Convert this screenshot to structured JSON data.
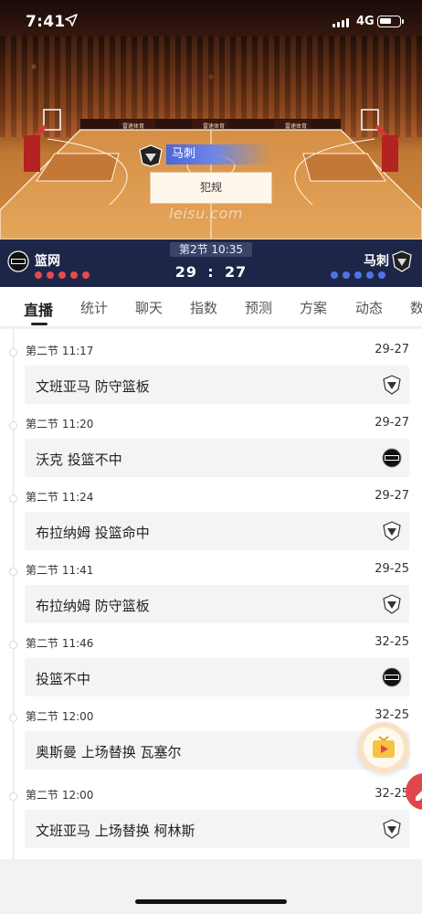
{
  "status_bar": {
    "time": "7:41",
    "network": "4G"
  },
  "live_event": {
    "team": "马刺",
    "action": "犯规",
    "watermark": "leisu.com"
  },
  "court_ads": [
    "雷速体育",
    "雷速体育",
    "雷速体育"
  ],
  "match": {
    "home_team": "篮网",
    "away_team": "马刺",
    "period_clock": "第2节 10:35",
    "home_score": "29",
    "away_score": "27",
    "separator": ":"
  },
  "team_logos": {
    "home": "NETS",
    "away": "SPURS"
  },
  "tabs": [
    {
      "label": "直播",
      "active": true
    },
    {
      "label": "统计"
    },
    {
      "label": "聊天"
    },
    {
      "label": "指数"
    },
    {
      "label": "预测"
    },
    {
      "label": "方案"
    },
    {
      "label": "动态"
    },
    {
      "label": "数"
    }
  ],
  "events": [
    {
      "time": "第二节 11:17",
      "score": "29-27",
      "text": "文班亚马 防守篮板",
      "team": "spurs"
    },
    {
      "time": "第二节 11:20",
      "score": "29-27",
      "text": "沃克 投篮不中",
      "team": "nets"
    },
    {
      "time": "第二节 11:24",
      "score": "29-27",
      "text": "布拉纳姆 投篮命中",
      "team": "spurs"
    },
    {
      "time": "第二节 11:41",
      "score": "29-25",
      "text": "布拉纳姆 防守篮板",
      "team": "spurs"
    },
    {
      "time": "第二节 11:46",
      "score": "32-25",
      "text": "投篮不中",
      "team": "nets"
    },
    {
      "time": "第二节 12:00",
      "score": "32-25",
      "text": "奥斯曼 上场替换 瓦塞尔",
      "team": "spurs"
    },
    {
      "time": "第二节 12:00",
      "score": "32-25",
      "text": "文班亚马 上场替换 柯林斯",
      "team": "spurs"
    }
  ],
  "colors": {
    "score_bar": "#1d2648",
    "home_dots": "#e64a4a",
    "away_dots": "#4f74e6",
    "event_highlight": "#4a66d8"
  },
  "icons": [
    "location-arrow-icon",
    "signal-icon",
    "battery-icon",
    "nets-logo-icon",
    "spurs-logo-icon",
    "video-icon",
    "edit-icon"
  ]
}
